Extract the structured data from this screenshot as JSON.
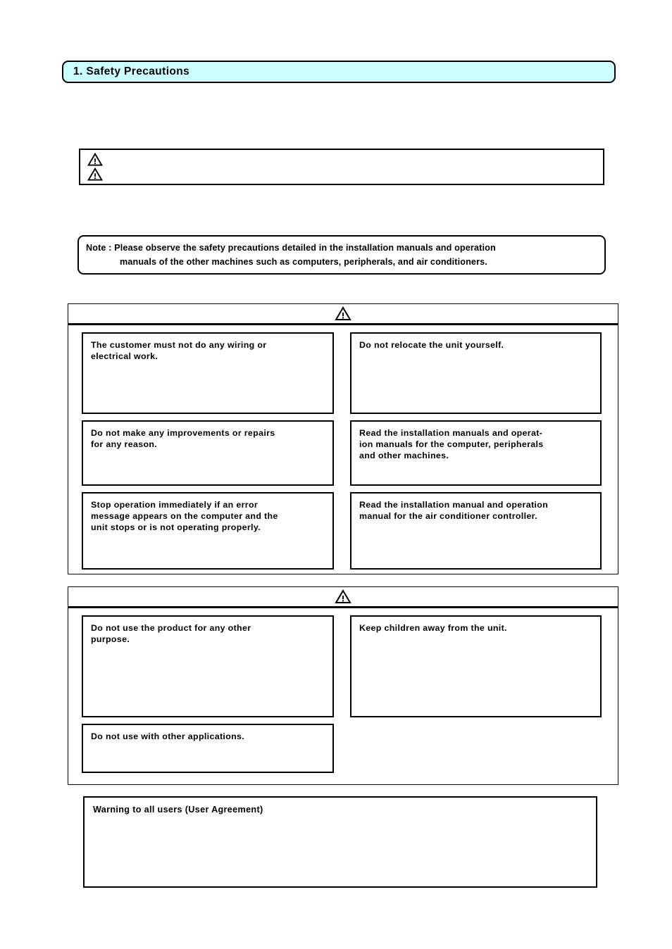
{
  "document": {
    "section_title": "1. Safety Precautions",
    "title_bar_color": "#ccffff"
  },
  "symbol_legend": {
    "icons": [
      "warning-triangle",
      "warning-triangle"
    ],
    "text": ""
  },
  "note": {
    "line1": "Note : Please observe the safety precautions detailed in the installation manuals and operation",
    "line2": "manuals of the other machines such as computers, peripherals, and air conditioners."
  },
  "warning_section": {
    "header_icon": "warning-triangle",
    "header_label": "",
    "items": [
      {
        "text": "The customer must not do any wiring or electrical work."
      },
      {
        "text": "Do not relocate the unit yourself."
      },
      {
        "text": "Do not make any improvements or repairs for any reason."
      },
      {
        "text": "Read the installation manuals and operat-ion manuals for the computer, peripherals and other machines."
      },
      {
        "text": "Stop operation immediately if an error message appears on the computer and the unit stops or is not operating properly."
      },
      {
        "text": "Read the installation manual and operation manual for the air conditioner controller."
      }
    ],
    "items_lines": [
      [
        "The customer must not do any wiring or",
        "electrical work."
      ],
      [
        "Do not relocate the unit yourself."
      ],
      [
        "Do not make any improvements or repairs",
        "for any reason."
      ],
      [
        "Read the installation manuals and operat-",
        "ion manuals for the computer, peripherals",
        "and other machines."
      ],
      [
        "Stop operation immediately if an error",
        "message appears on the computer and the",
        "unit stops or is not operating properly."
      ],
      [
        "Read the installation manual and operation",
        "manual for the air conditioner controller."
      ]
    ]
  },
  "caution_section": {
    "header_icon": "warning-triangle",
    "header_label": "",
    "items": [
      {
        "text": "Do not use the product for any other purpose."
      },
      {
        "text": "Keep children away from the unit."
      },
      {
        "text": "Do not use with other applications."
      }
    ],
    "items_lines": [
      [
        "Do not use the product for any other",
        "purpose."
      ],
      [
        "Keep children away from the unit."
      ],
      [
        "Do not use with other applications."
      ]
    ]
  },
  "agreement": {
    "title": "Warning to all users (User Agreement)",
    "body": ""
  }
}
